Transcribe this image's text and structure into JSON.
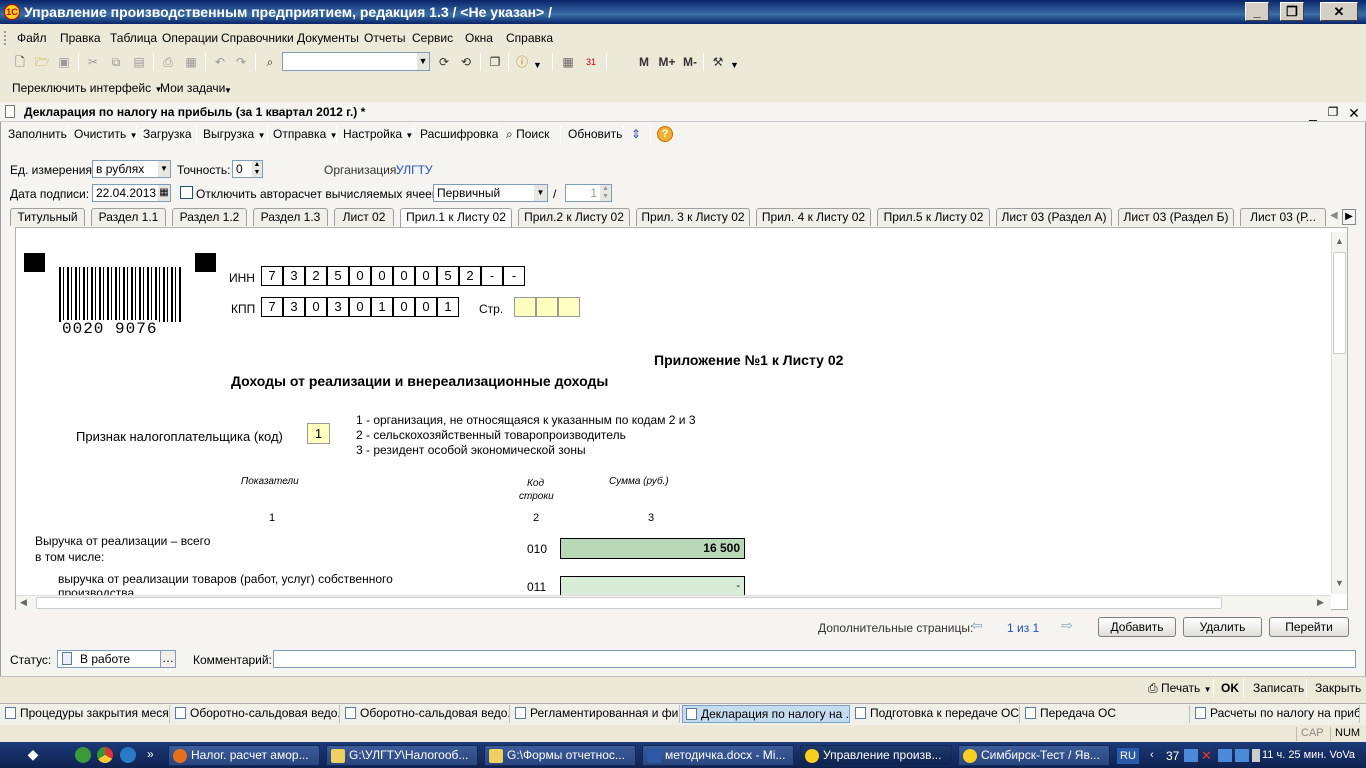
{
  "app": {
    "title": "Управление производственным предприятием, редакция 1.3 / <Не указан> /",
    "icon": "1C"
  },
  "menu": [
    "Файл",
    "Правка",
    "Таблица",
    "Операции",
    "Справочники",
    "Документы",
    "Отчеты",
    "Сервис",
    "Окна",
    "Справка"
  ],
  "toolbar2": {
    "switch_interface": "Переключить интерфейс",
    "my_tasks": "Мои задачи",
    "m": "M",
    "mplus": "M+",
    "mminus": "M-"
  },
  "doc": {
    "title": "Декларация по налогу на прибыль (за 1 квартал 2012 г.) *",
    "commands": [
      "Заполнить",
      "Очистить",
      "Загрузка",
      "Выгрузка",
      "Отправка",
      "Настройка",
      "Расшифровка",
      "Поиск",
      "Обновить"
    ],
    "unit_label": "Ед. измерения:",
    "unit_value": "в рублях",
    "precision_label": "Точность:",
    "precision_value": "0",
    "org_label": "Организация:",
    "org_value": "УЛГТУ",
    "date_label": "Дата подписи:",
    "date_value": "22.04.2013",
    "autocalc_label": "Отключить авторасчет вычисляемых ячеек",
    "kind_value": "Первичный",
    "slash": "/",
    "corr_value": "1",
    "tabs": [
      "Титульный",
      "Раздел 1.1",
      "Раздел 1.2",
      "Раздел 1.3",
      "Лист 02",
      "Прил.1 к Листу 02",
      "Прил.2 к Листу 02",
      "Прил. 3 к Листу 02",
      "Прил. 4 к Листу 02",
      "Прил.5 к Листу 02",
      "Лист 03 (Раздел А)",
      "Лист 03 (Раздел Б)",
      "Лист 03 (Р..."
    ],
    "active_tab": 5
  },
  "sheet": {
    "barcode": "0020 9076",
    "inn_label": "ИНН",
    "inn": [
      "7",
      "3",
      "2",
      "5",
      "0",
      "0",
      "0",
      "0",
      "5",
      "2",
      "-",
      "-"
    ],
    "kpp_label": "КПП",
    "kpp": [
      "7",
      "3",
      "0",
      "3",
      "0",
      "1",
      "0",
      "0",
      "1"
    ],
    "page_label": "Стр.",
    "appendix_title": "Приложение №1 к Листу 02",
    "income_title": "Доходы от реализации и внереализационные доходы",
    "taxpayer_label": "Признак налогоплательщика (код)",
    "taxpayer_code": "1",
    "codes": [
      "1 - организация, не относящаяся к указанным по кодам 2 и 3",
      "2 - сельскохозяйственный товаропроизводитель",
      "3 - резидент особой экономической зоны"
    ],
    "col_indicators": "Показатели",
    "col_code_1": "Код",
    "col_code_2": "строки",
    "col_sum": "Сумма (руб.)",
    "col_n1": "1",
    "col_n2": "2",
    "col_n3": "3",
    "row1_label_1": "Выручка от реализации – всего",
    "row1_label_2": "в том числе:",
    "row1_code": "010",
    "row1_value": "16 500",
    "row2_label_1": "выручка от реализации товаров (работ, услуг) собственного",
    "row2_label_2": "производства",
    "row2_code": "011",
    "row2_value": "-"
  },
  "bottom": {
    "extra_pages_label": "Дополнительные страницы:",
    "page_counter": "1 из 1",
    "add": "Добавить",
    "delete": "Удалить",
    "goto": "Перейти",
    "status_label": "Статус:",
    "status_value": "В работе",
    "comment_label": "Комментарий:",
    "print": "Печать",
    "ok": "OK",
    "save": "Записать",
    "close": "Закрыть"
  },
  "taskpanel": [
    "Процедуры закрытия меся...",
    "Оборотно-сальдовая ведо...",
    "Оборотно-сальдовая ведо...",
    "Регламентированная и фи...",
    "Декларация по налогу на ...",
    "Подготовка к передаче ОС",
    "Передача ОС",
    "Расчеты по налогу на приб..."
  ],
  "statusbar": {
    "cap": "CAP",
    "num": "NUM"
  },
  "taskbar": {
    "items": [
      "Налог. расчет амор...",
      "G:\\УЛГТУ\\Налогооб...",
      "G:\\Формы отчетнос...",
      "методичка.docx - Mi...",
      "Управление произв...",
      "Симбирск-Тест / Яв..."
    ],
    "lang": "RU",
    "tray_num": "37",
    "clock": "11 ч. 25 мин. VoVa"
  }
}
